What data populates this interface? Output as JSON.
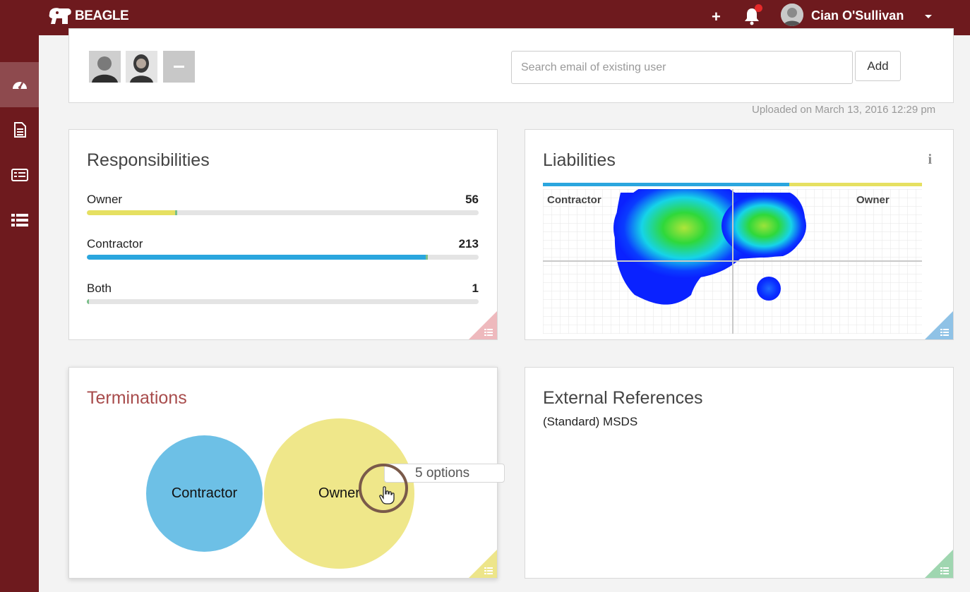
{
  "app": {
    "brand": "BEAGLE"
  },
  "topbar": {
    "plus_icon": "plus-icon",
    "bell_icon": "bell-icon",
    "user_name": "Cian O'Sullivan",
    "colors": {
      "bar": "#6e1a1e",
      "notification": "#e62a2a"
    }
  },
  "sidebar": {
    "items": [
      {
        "icon": "dashboard-icon",
        "active": true
      },
      {
        "icon": "document-icon",
        "active": false
      },
      {
        "icon": "card-list-icon",
        "active": false
      },
      {
        "icon": "list-icon",
        "active": false
      }
    ]
  },
  "users": {
    "search_placeholder": "Search email of existing user",
    "add_label": "Add",
    "uploaded": "Uploaded on March 13, 2016 12:29 pm"
  },
  "responsibilities": {
    "title": "Responsibilities",
    "rows": [
      {
        "label": "Owner",
        "count": "56",
        "fraction": 0.23,
        "color": "#e6e061"
      },
      {
        "label": "Contractor",
        "count": "213",
        "fraction": 0.87,
        "color": "#2aa6de"
      },
      {
        "label": "Both",
        "count": "1",
        "fraction": 0.005,
        "color": "#7bbf8a"
      }
    ]
  },
  "liabilities": {
    "title": "Liabilities",
    "info_icon": "info-icon",
    "left_label": "Contractor",
    "right_label": "Owner",
    "split": {
      "contractor_fraction": 0.65,
      "contractor_color": "#2aa6de",
      "owner_color": "#e6e061"
    }
  },
  "terminations": {
    "title": "Terminations",
    "title_color": "#a84c4c",
    "bubbles": [
      {
        "label": "Contractor",
        "color": "#6dc0e6"
      },
      {
        "label": "Owner",
        "color": "#efe78a"
      }
    ],
    "tooltip": "5 options"
  },
  "external_references": {
    "title": "External References",
    "items": [
      "(Standard) MSDS"
    ]
  }
}
